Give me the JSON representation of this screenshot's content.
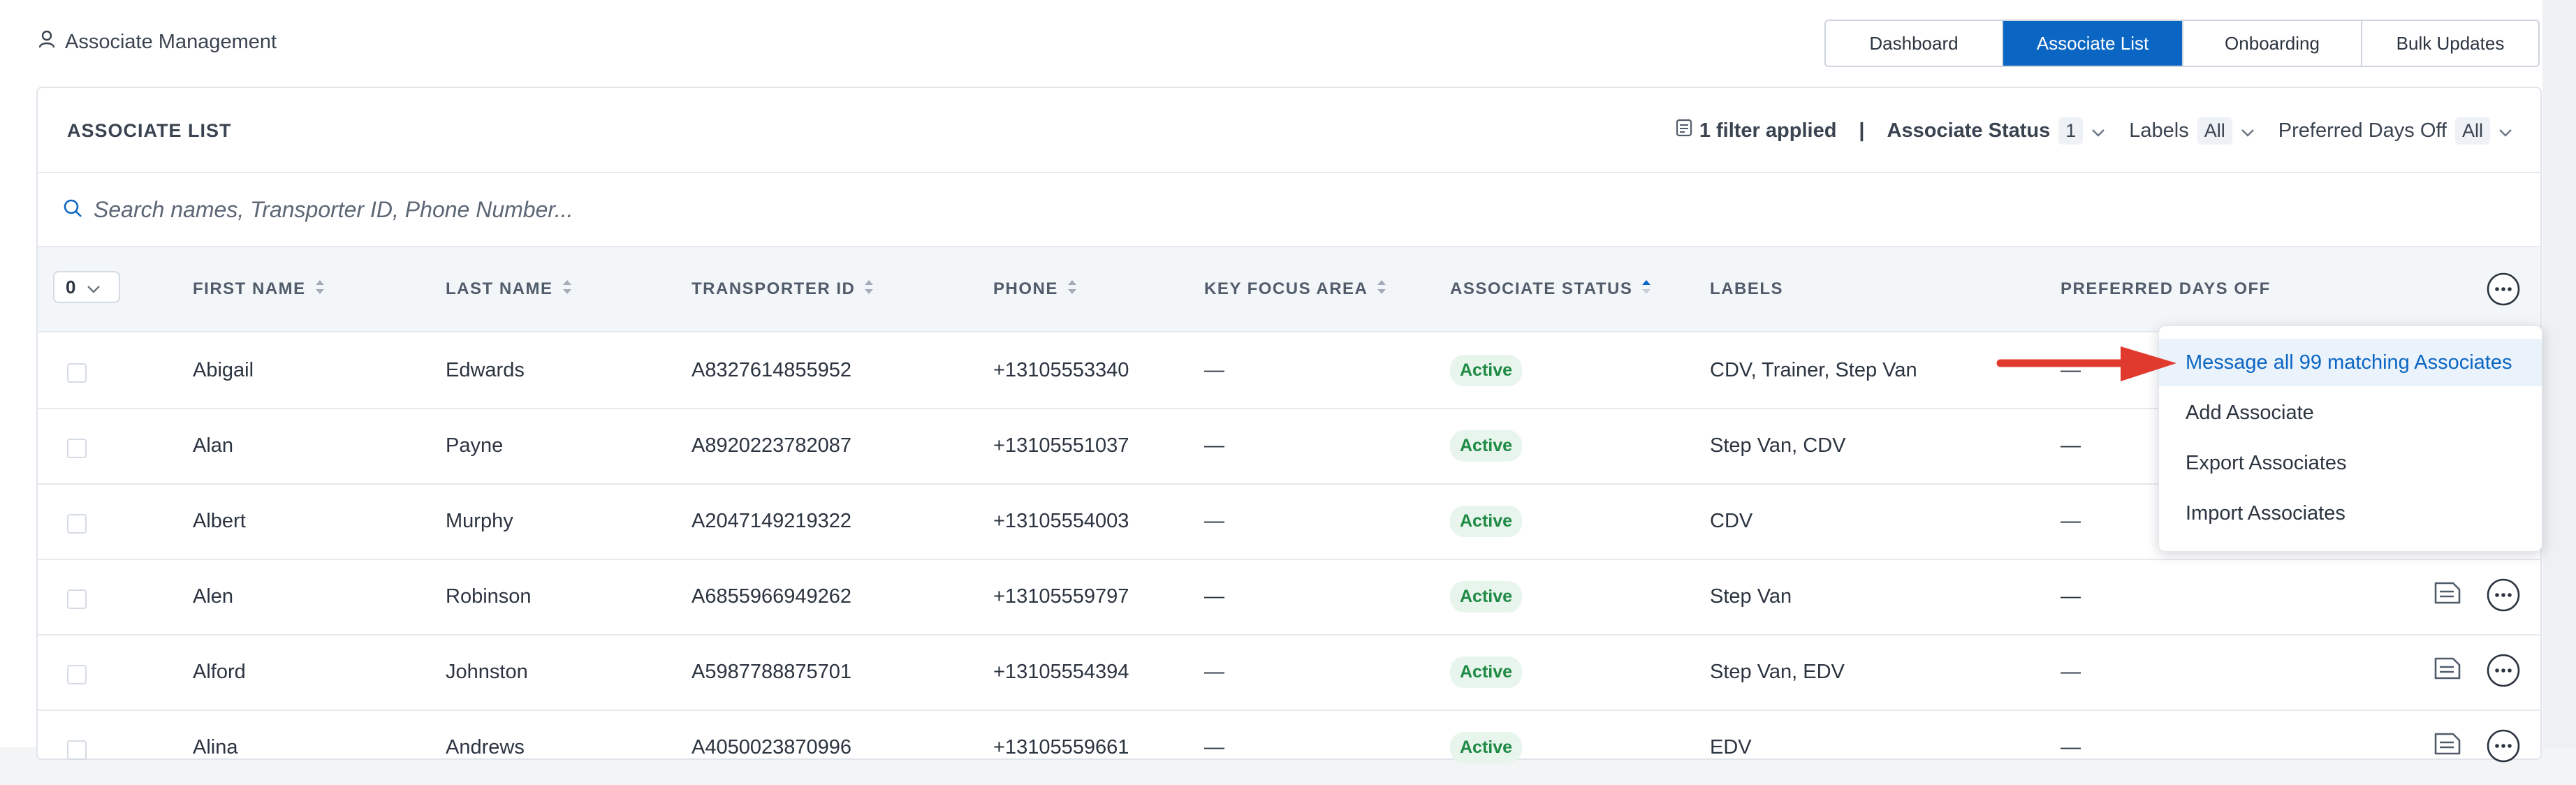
{
  "app": {
    "title": "Associate Management"
  },
  "nav": {
    "tabs": [
      "Dashboard",
      "Associate List",
      "Onboarding",
      "Bulk Updates"
    ],
    "active": "Associate List"
  },
  "panel": {
    "title": "ASSOCIATE LIST"
  },
  "filters": {
    "applied": "1 filter applied",
    "separator": "|",
    "status": {
      "label": "Associate Status",
      "value": "1"
    },
    "labels": {
      "label": "Labels",
      "value": "All"
    },
    "days_off": {
      "label": "Preferred Days Off",
      "value": "All"
    }
  },
  "search": {
    "placeholder": "Search names, Transporter ID, Phone Number..."
  },
  "table": {
    "selected_count": "0",
    "columns": {
      "first_name": "FIRST NAME",
      "last_name": "LAST NAME",
      "transporter_id": "TRANSPORTER ID",
      "phone": "PHONE",
      "key_focus_area": "KEY FOCUS AREA",
      "associate_status": "ASSOCIATE STATUS",
      "labels": "LABELS",
      "preferred_days_off": "PREFERRED DAYS OFF"
    },
    "rows": [
      {
        "first": "Abigail",
        "last": "Edwards",
        "tid": "A8327614855952",
        "phone": "+13105553340",
        "kfa": "—",
        "status": "Active",
        "labels": "CDV, Trainer, Step Van",
        "days": "—"
      },
      {
        "first": "Alan",
        "last": "Payne",
        "tid": "A8920223782087",
        "phone": "+13105551037",
        "kfa": "—",
        "status": "Active",
        "labels": "Step Van, CDV",
        "days": "—"
      },
      {
        "first": "Albert",
        "last": "Murphy",
        "tid": "A2047149219322",
        "phone": "+13105554003",
        "kfa": "—",
        "status": "Active",
        "labels": "CDV",
        "days": "—"
      },
      {
        "first": "Alen",
        "last": "Robinson",
        "tid": "A6855966949262",
        "phone": "+13105559797",
        "kfa": "—",
        "status": "Active",
        "labels": "Step Van",
        "days": "—"
      },
      {
        "first": "Alford",
        "last": "Johnston",
        "tid": "A5987788875701",
        "phone": "+13105554394",
        "kfa": "—",
        "status": "Active",
        "labels": "Step Van, EDV",
        "days": "—"
      },
      {
        "first": "Alina",
        "last": "Andrews",
        "tid": "A4050023870996",
        "phone": "+13105559661",
        "kfa": "—",
        "status": "Active",
        "labels": "EDV",
        "days": "—"
      }
    ]
  },
  "menu": {
    "items": [
      "Message all 99 matching Associates",
      "Add Associate",
      "Export Associates",
      "Import Associates"
    ]
  },
  "colors": {
    "primary": "#0b66c3",
    "active_badge_bg": "#e8f5ec",
    "active_badge_text": "#1e8a45",
    "annotation_arrow": "#e03a2f"
  },
  "icons": {
    "app": "user-icon",
    "filter": "filter-doc-icon",
    "search": "search-icon",
    "more": "more-horizontal-icon",
    "note": "note-icon"
  }
}
